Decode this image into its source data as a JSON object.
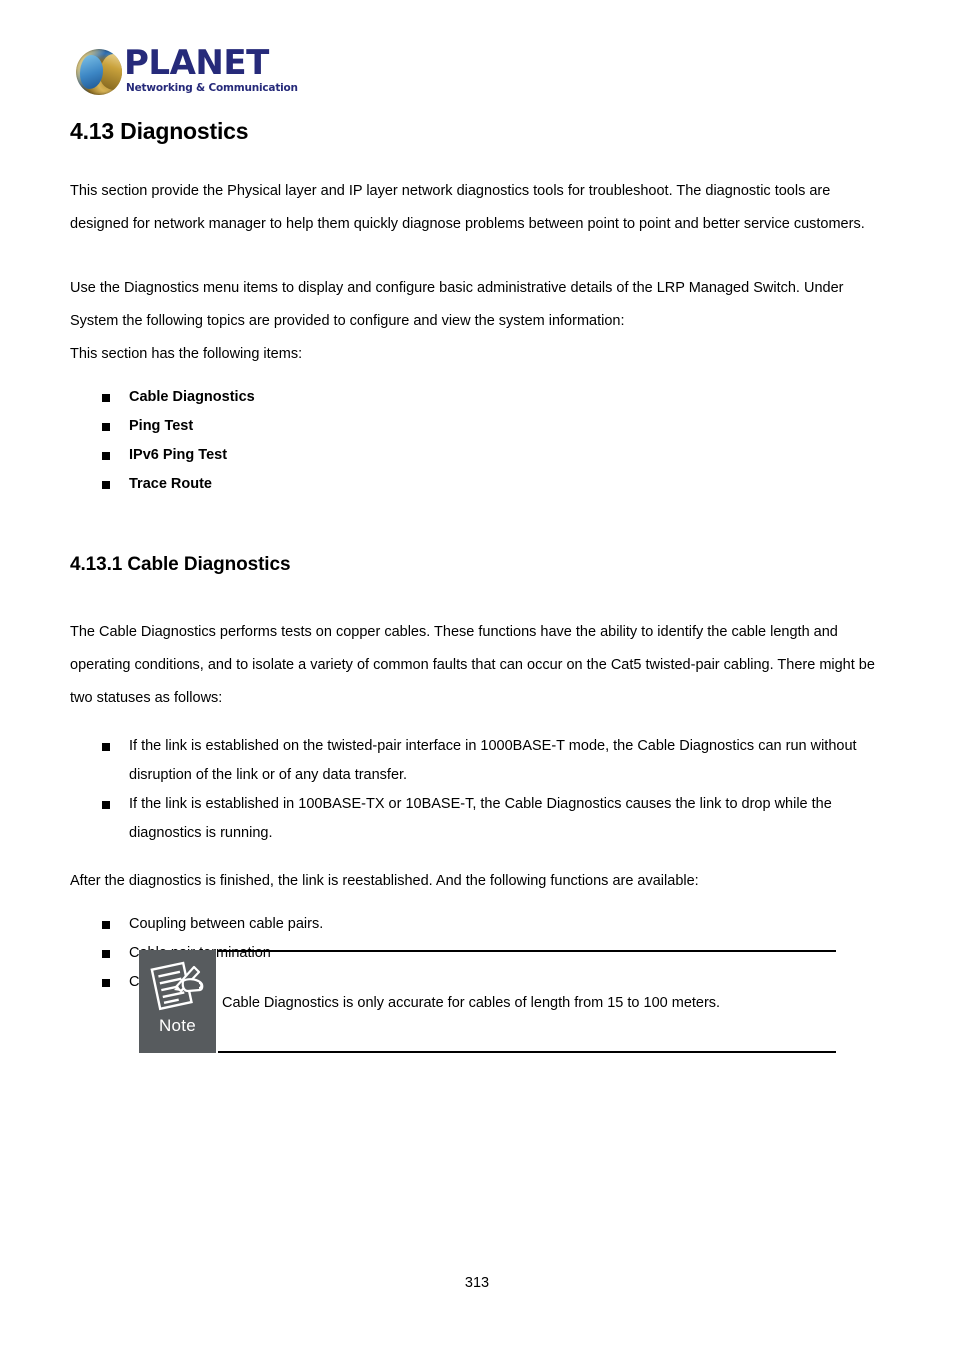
{
  "header": {
    "logo_wordmark": "PLANET",
    "logo_tagline": "Networking & Communication",
    "logo_icon_name": "planet-globe-logo"
  },
  "section": {
    "title": "4.13 Diagnostics",
    "intro_paragraph_1": "This section provide the Physical layer and IP layer network diagnostics tools for troubleshoot. The diagnostic tools are designed for network manager to help them quickly diagnose problems between point to point and better service customers.",
    "intro_paragraph_2": "Use the Diagnostics menu items to display and configure basic administrative details of the LRP Managed Switch. Under System the following topics are provided to configure and view the system information:",
    "intro_paragraph_3": "This section has the following items:",
    "topic_items": [
      "Cable Diagnostics",
      "Ping Test",
      "IPv6 Ping Test",
      "Trace Route"
    ]
  },
  "subsection": {
    "title": "4.13.1 Cable Diagnostics",
    "paragraph_1": "The Cable Diagnostics performs tests on copper cables. These functions have the ability to identify the cable length and operating conditions, and to isolate a variety of common faults that can occur on the Cat5 twisted-pair cabling. There might be two statuses as follows:",
    "status_items": [
      "If the link is established on the twisted-pair interface in 1000BASE-T mode, the Cable Diagnostics can run without disruption of the link or of any data transfer.",
      "If the link is established in 100BASE-TX or 10BASE-T, the Cable Diagnostics causes the link to drop while the diagnostics is running."
    ],
    "paragraph_2": "After the diagnostics is finished, the link is reestablished. And the following functions are available:",
    "function_items": [
      "Coupling between cable pairs.",
      "Cable pair termination",
      "Cable length"
    ]
  },
  "note": {
    "label": "Note",
    "icon_name": "note-pen-paper-icon",
    "text": "Cable Diagnostics is only accurate for cables of length from 15 to 100 meters.",
    "box_color": "#575b5e"
  },
  "footer": {
    "page_number": "313"
  }
}
